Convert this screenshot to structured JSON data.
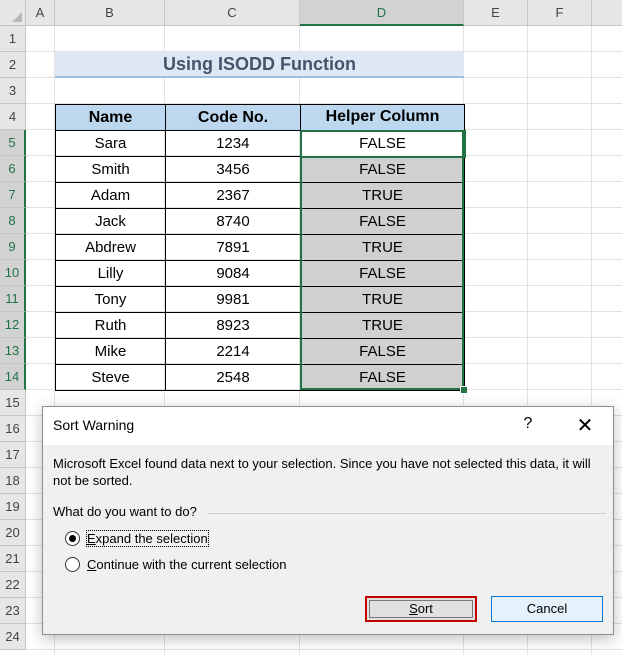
{
  "columns": [
    "A",
    "B",
    "C",
    "D",
    "E",
    "F"
  ],
  "rows": [
    "1",
    "2",
    "3",
    "4",
    "5",
    "6",
    "7",
    "8",
    "9",
    "10",
    "11",
    "12",
    "13",
    "14",
    "15",
    "16",
    "17",
    "18",
    "19",
    "20",
    "21",
    "22",
    "23",
    "24"
  ],
  "title": "Using ISODD Function",
  "table": {
    "headers": [
      "Name",
      "Code No.",
      "Helper Column"
    ],
    "rows": [
      [
        "Sara",
        "1234",
        "FALSE"
      ],
      [
        "Smith",
        "3456",
        "FALSE"
      ],
      [
        "Adam",
        "2367",
        "TRUE"
      ],
      [
        "Jack",
        "8740",
        "FALSE"
      ],
      [
        "Abdrew",
        "7891",
        "TRUE"
      ],
      [
        "Lilly",
        "9084",
        "FALSE"
      ],
      [
        "Tony",
        "9981",
        "TRUE"
      ],
      [
        "Ruth",
        "8923",
        "TRUE"
      ],
      [
        "Mike",
        "2214",
        "FALSE"
      ],
      [
        "Steve",
        "2548",
        "FALSE"
      ]
    ]
  },
  "dialog": {
    "title": "Sort Warning",
    "help": "?",
    "close": "✕",
    "message": "Microsoft Excel found data next to your selection.  Since you have not selected this data, it will not be sorted.",
    "question": "What do you want to do?",
    "option_expand": "Expand the selection",
    "option_continue": "Continue with the current selection",
    "sort_label": "Sort",
    "cancel_label": "Cancel"
  }
}
